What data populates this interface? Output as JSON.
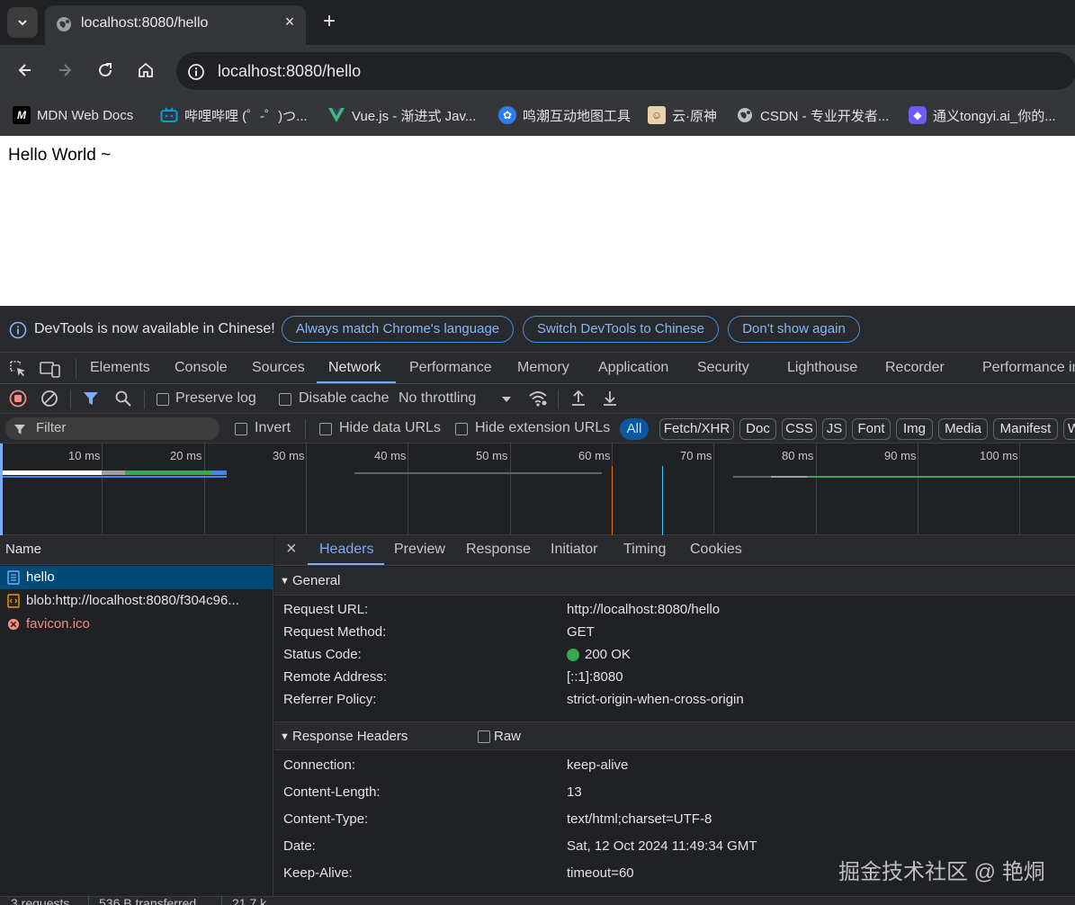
{
  "browser": {
    "tab_title": "localhost:8080/hello",
    "tab_close": "×",
    "new_tab": "+",
    "url": "localhost:8080/hello"
  },
  "bookmarks": [
    {
      "label": "MDN Web Docs",
      "icon": "mdn-icon",
      "color": "#000000"
    },
    {
      "label": "哔哩哔哩 (゜-゜)つ...",
      "icon": "bilibili-icon",
      "color": "#00a1d6"
    },
    {
      "label": "Vue.js - 渐进式 Jav...",
      "icon": "vue-icon",
      "color": "#41b883"
    },
    {
      "label": "鸣潮互动地图工具",
      "icon": "map-tool-icon",
      "color": "#2b7de9"
    },
    {
      "label": "云·原神",
      "icon": "genshin-icon",
      "color": "#c9a86a"
    },
    {
      "label": "CSDN - 专业开发者...",
      "icon": "globe-icon",
      "color": "#bdc1c6"
    },
    {
      "label": "通义tongyi.ai_你的...",
      "icon": "tongyi-icon",
      "color": "#6b5cf6"
    }
  ],
  "page": {
    "content": "Hello World ~"
  },
  "devtools": {
    "banner": {
      "message": "DevTools is now available in Chinese!",
      "btn_match": "Always match Chrome's language",
      "btn_switch": "Switch DevTools to Chinese",
      "btn_dont_show": "Don't show again"
    },
    "tabs": [
      "Elements",
      "Console",
      "Sources",
      "Network",
      "Performance",
      "Memory",
      "Application",
      "Security",
      "Lighthouse",
      "Recorder",
      "Performance in"
    ],
    "active_tab": "Network",
    "network_toolbar": {
      "preserve_log": "Preserve log",
      "disable_cache": "Disable cache",
      "throttling": "No throttling"
    },
    "filter": {
      "placeholder": "Filter",
      "invert": "Invert",
      "hide_data_urls": "Hide data URLs",
      "hide_extension_urls": "Hide extension URLs",
      "types": [
        "All",
        "Fetch/XHR",
        "Doc",
        "CSS",
        "JS",
        "Font",
        "Img",
        "Media",
        "Manifest",
        "W"
      ]
    },
    "timeline": {
      "ticks": [
        "10 ms",
        "20 ms",
        "30 ms",
        "40 ms",
        "50 ms",
        "60 ms",
        "70 ms",
        "80 ms",
        "90 ms",
        "100 ms"
      ]
    },
    "requests": {
      "header": "Name",
      "items": [
        {
          "name": "hello",
          "type": "doc",
          "selected": true
        },
        {
          "name": "blob:http://localhost:8080/f304c96...",
          "type": "script",
          "selected": false
        },
        {
          "name": "favicon.ico",
          "type": "error",
          "selected": false
        }
      ],
      "footer": {
        "count": "3 requests",
        "transferred": "536 B transferred",
        "resources": "21.7 k"
      }
    },
    "detail": {
      "close": "×",
      "tabs": [
        "Headers",
        "Preview",
        "Response",
        "Initiator",
        "Timing",
        "Cookies"
      ],
      "active_tab": "Headers",
      "general": {
        "title": "General",
        "rows": [
          {
            "key": "Request URL:",
            "value": "http://localhost:8080/hello"
          },
          {
            "key": "Request Method:",
            "value": "GET"
          },
          {
            "key": "Status Code:",
            "value": "200 OK"
          },
          {
            "key": "Remote Address:",
            "value": "[::1]:8080"
          },
          {
            "key": "Referrer Policy:",
            "value": "strict-origin-when-cross-origin"
          }
        ]
      },
      "response_headers": {
        "title": "Response Headers",
        "raw_label": "Raw",
        "rows": [
          {
            "key": "Connection:",
            "value": "keep-alive"
          },
          {
            "key": "Content-Length:",
            "value": "13"
          },
          {
            "key": "Content-Type:",
            "value": "text/html;charset=UTF-8"
          },
          {
            "key": "Date:",
            "value": "Sat, 12 Oct 2024 11:49:34 GMT"
          },
          {
            "key": "Keep-Alive:",
            "value": "timeout=60"
          }
        ]
      }
    }
  },
  "watermark": "掘金技术社区 @ 艳烔",
  "colors": {
    "accent": "#7cacf8",
    "status_ok": "#34a853",
    "error": "#f28b82",
    "selected_row": "#004a77"
  }
}
